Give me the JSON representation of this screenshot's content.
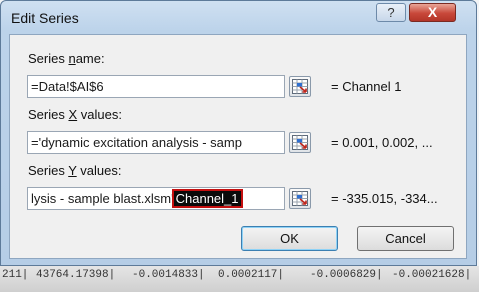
{
  "window": {
    "title": "Edit Series",
    "help_glyph": "?",
    "close_glyph": "X"
  },
  "series_name": {
    "label_pre": "Series ",
    "label_key": "n",
    "label_post": "ame:",
    "value": "=Data!$AI$6",
    "preview": "= Channel 1"
  },
  "series_x": {
    "label_pre": "Series ",
    "label_key": "X",
    "label_post": " values:",
    "value": "='dynamic excitation analysis - samp",
    "preview": "= 0.001, 0.002, ..."
  },
  "series_y": {
    "label_pre": "Series ",
    "label_key": "Y",
    "label_post": " values:",
    "value_prefix": "lysis - sample blast.xlsm'",
    "value_selected": "Channel_1",
    "preview": "= -335.015, -334..."
  },
  "buttons": {
    "ok": "OK",
    "cancel": "Cancel"
  },
  "background_row": [
    "211|",
    "43764.17398|",
    "-0.0014833|",
    "0.0002117|",
    "-0.0006829|",
    "-0.00021628|"
  ],
  "icons": {
    "collapse": "range-collapse-icon"
  }
}
